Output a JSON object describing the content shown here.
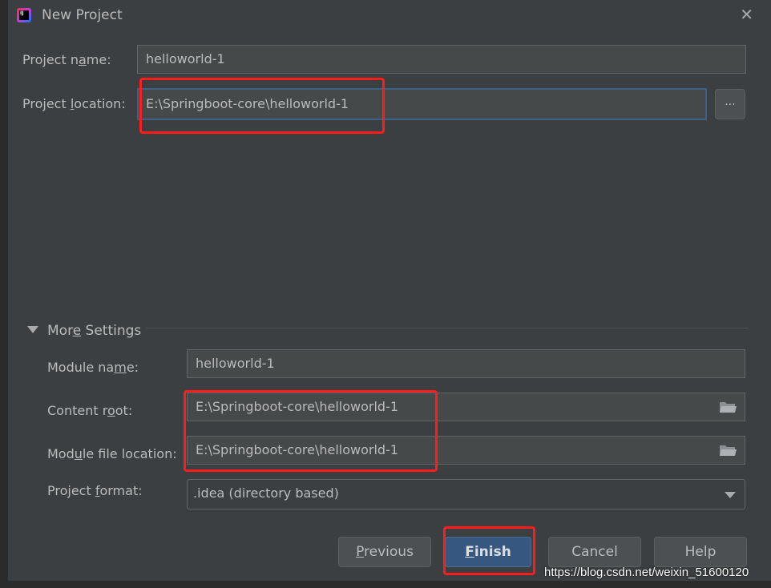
{
  "window": {
    "title": "New Project",
    "icon": "intellij-idea-icon",
    "close_icon": "close-icon"
  },
  "fields": {
    "project_name": {
      "label": {
        "pre": "Project n",
        "mn": "a",
        "post": "me:"
      },
      "value": "helloworld-1"
    },
    "project_location": {
      "label": {
        "pre": "Project ",
        "mn": "l",
        "post": "ocation:"
      },
      "value": "E:\\Springboot-core\\helloworld-1",
      "browse_label": "..."
    }
  },
  "more_settings": {
    "title": {
      "pre": "Mor",
      "mn": "e",
      "post": " Settings"
    },
    "expanded": true,
    "module_name": {
      "label": {
        "pre": "Module na",
        "mn": "m",
        "post": "e:"
      },
      "value": "helloworld-1"
    },
    "content_root": {
      "label": {
        "pre": "Content r",
        "mn": "o",
        "post": "ot:"
      },
      "value": "E:\\Springboot-core\\helloworld-1",
      "icon": "folder-icon"
    },
    "module_file_location": {
      "label": {
        "pre": "Mod",
        "mn": "u",
        "post": "le file location:"
      },
      "value": "E:\\Springboot-core\\helloworld-1",
      "icon": "folder-icon"
    },
    "project_format": {
      "label": {
        "pre": "Project ",
        "mn": "f",
        "post": "ormat:"
      },
      "value": ".idea (directory based)"
    }
  },
  "buttons": {
    "previous": {
      "pre": "",
      "mn": "P",
      "post": "revious"
    },
    "finish": {
      "pre": "",
      "mn": "F",
      "post": "inish"
    },
    "cancel": "Cancel",
    "help": "Help"
  },
  "watermark": "https://blog.csdn.net/weixin_51600120",
  "colors": {
    "background": "#3c3f41",
    "field": "#45494a",
    "primary_button": "#365880",
    "annotation": "#ff1c1c"
  }
}
